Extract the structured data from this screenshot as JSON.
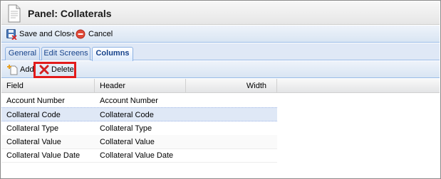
{
  "panel": {
    "title": "Panel: Collaterals"
  },
  "toolbar": {
    "save_close_label": "Save and Close",
    "cancel_label": "Cancel"
  },
  "tabs": [
    {
      "label": "General",
      "active": false
    },
    {
      "label": "Edit Screens",
      "active": false
    },
    {
      "label": "Columns",
      "active": true
    }
  ],
  "gridbar": {
    "add_label": "Add",
    "delete_label": "Delete"
  },
  "grid": {
    "columns": [
      "Field",
      "Header",
      "Width"
    ],
    "rows": [
      {
        "field": "Account Number",
        "header": "Account Number",
        "width": "",
        "selected": false
      },
      {
        "field": "Collateral Code",
        "header": "Collateral Code",
        "width": "",
        "selected": true
      },
      {
        "field": "Collateral Type",
        "header": "Collateral Type",
        "width": "",
        "selected": false
      },
      {
        "field": "Collateral Value",
        "header": "Collateral Value",
        "width": "",
        "selected": false
      },
      {
        "field": "Collateral Value Date",
        "header": "Collateral Value Date",
        "width": "",
        "selected": false
      }
    ]
  },
  "colors": {
    "highlight": "#e21b1b",
    "tab_text": "#15428b",
    "selected_row": "#dfe8f6"
  },
  "icons": [
    "document-icon",
    "save-close-icon",
    "cancel-icon",
    "add-icon",
    "delete-icon"
  ]
}
